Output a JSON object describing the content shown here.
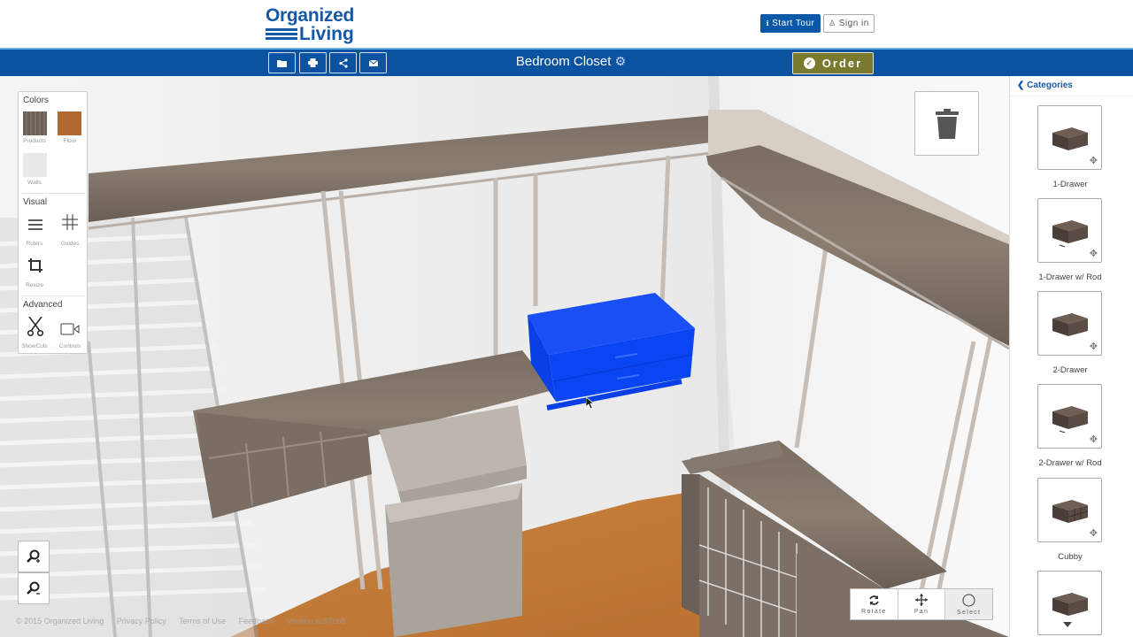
{
  "brand": {
    "line1": "Organized",
    "line2": "Living"
  },
  "header": {
    "start_tour": "Start Tour",
    "sign_in": "Sign in",
    "start_tour_icon": "info-icon",
    "sign_in_icon": "user-icon"
  },
  "toolbar": {
    "buttons": [
      {
        "name": "open",
        "icon": "folder-icon"
      },
      {
        "name": "print",
        "icon": "print-icon"
      },
      {
        "name": "share",
        "icon": "share-icon"
      },
      {
        "name": "email",
        "icon": "envelope-icon"
      }
    ],
    "project_title": "Bedroom Closet",
    "order_label": "Order"
  },
  "colors": {
    "brand_blue": "#1558a8",
    "nav_blue": "#0b52a0",
    "order_olive": "#7a7a2e",
    "selected_item": "#0a3ff0"
  },
  "left_panel": {
    "colors_heading": "Colors",
    "swatches": [
      {
        "label": "Products",
        "color": "#6b6058"
      },
      {
        "label": "Floor",
        "color": "#b06a30"
      },
      {
        "label": "Walls",
        "color": "#e8e8e8"
      }
    ],
    "visual_heading": "Visual",
    "visual_tools": [
      {
        "label": "Rulers",
        "icon": "rulers-icon"
      },
      {
        "label": "Guides",
        "icon": "guides-icon"
      },
      {
        "label": "Resize",
        "icon": "crop-icon"
      }
    ],
    "advanced_heading": "Advanced",
    "advanced_tools": [
      {
        "label": "ShowCuts",
        "icon": "scissors-icon"
      },
      {
        "label": "Controls",
        "icon": "camera-icon"
      }
    ]
  },
  "view_modes": [
    {
      "label": "Rotate",
      "icon": "rotate-icon"
    },
    {
      "label": "Pan",
      "icon": "move-icon"
    },
    {
      "label": "Select",
      "icon": "circle-icon",
      "active": true
    }
  ],
  "footer": {
    "copyright": "© 2015 Organized Living",
    "privacy": "Privacy Policy",
    "terms": "Terms of Use",
    "feedback": "Feedback",
    "version": "Version ac87cb8"
  },
  "sidebar": {
    "back_label": "Categories",
    "products": [
      {
        "name": "1-Drawer"
      },
      {
        "name": "1-Drawer w/ Rod"
      },
      {
        "name": "2-Drawer"
      },
      {
        "name": "2-Drawer w/ Rod"
      },
      {
        "name": "Cubby"
      },
      {
        "name": ""
      }
    ]
  }
}
